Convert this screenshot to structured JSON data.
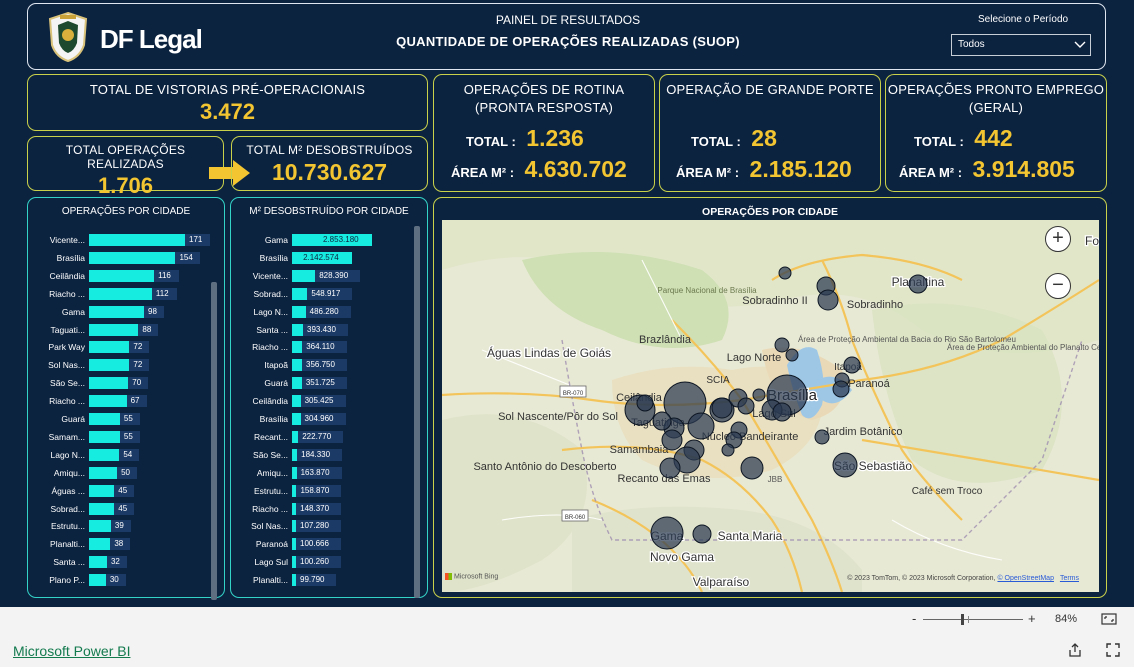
{
  "header": {
    "brand": "DF Legal",
    "title_line1": "PAINEL DE RESULTADOS",
    "title_line2": "QUANTIDADE DE OPERAÇÕES REALIZADAS (SUOP)",
    "period_label": "Selecione o Período",
    "period_value": "Todos"
  },
  "kpis": {
    "vistorias_label": "TOTAL DE VISTORIAS PRÉ-OPERACIONAIS",
    "vistorias_value": "3.472",
    "operacoes_label": "TOTAL OPERAÇÕES REALIZADAS",
    "operacoes_value": "1.706",
    "m2_label": "TOTAL M² DESOBSTRUÍDOS",
    "m2_value": "10.730.627",
    "total_label": "TOTAL :",
    "area_label": "ÁREA M² :",
    "rotina_title_1": "OPERAÇÕES DE ROTINA",
    "rotina_title_2": "(PRONTA RESPOSTA)",
    "rotina_total": "1.236",
    "rotina_area": "4.630.702",
    "grande_title": "OPERAÇÃO DE GRANDE PORTE",
    "grande_total": "28",
    "grande_area": "2.185.120",
    "pronto_title_1": "OPERAÇÕES PRONTO EMPREGO",
    "pronto_title_2": "(GERAL)",
    "pronto_total": "442",
    "pronto_area": "3.914.805"
  },
  "chart_ops": {
    "title": "OPERAÇÕES POR CIDADE",
    "max": 171,
    "rows": [
      {
        "label": "Vicente...",
        "value": 171,
        "text": "171"
      },
      {
        "label": "Brasília",
        "value": 154,
        "text": "154"
      },
      {
        "label": "Ceilândia",
        "value": 116,
        "text": "116"
      },
      {
        "label": "Riacho ...",
        "value": 112,
        "text": "112"
      },
      {
        "label": "Gama",
        "value": 98,
        "text": "98"
      },
      {
        "label": "Taguati...",
        "value": 88,
        "text": "88"
      },
      {
        "label": "Park Way",
        "value": 72,
        "text": "72"
      },
      {
        "label": "Sol Nas...",
        "value": 72,
        "text": "72"
      },
      {
        "label": "São Se...",
        "value": 70,
        "text": "70"
      },
      {
        "label": "Riacho ...",
        "value": 67,
        "text": "67"
      },
      {
        "label": "Guará",
        "value": 55,
        "text": "55"
      },
      {
        "label": "Samam...",
        "value": 55,
        "text": "55"
      },
      {
        "label": "Lago N...",
        "value": 54,
        "text": "54"
      },
      {
        "label": "Amiqu...",
        "value": 50,
        "text": "50"
      },
      {
        "label": "Águas ...",
        "value": 45,
        "text": "45"
      },
      {
        "label": "Sobrad...",
        "value": 45,
        "text": "45"
      },
      {
        "label": "Estrutu...",
        "value": 39,
        "text": "39"
      },
      {
        "label": "Planalti...",
        "value": 38,
        "text": "38"
      },
      {
        "label": "Santa ...",
        "value": 32,
        "text": "32"
      },
      {
        "label": "Plano P...",
        "value": 30,
        "text": "30"
      }
    ]
  },
  "chart_m2": {
    "title": "M² DESOBSTRUÍDO POR CIDADE",
    "max": 2853180,
    "rows": [
      {
        "label": "Gama",
        "value": 2853180,
        "text": "2.853.180"
      },
      {
        "label": "Brasília",
        "value": 2142574,
        "text": "2.142.574"
      },
      {
        "label": "Vicente...",
        "value": 828390,
        "text": "828.390"
      },
      {
        "label": "Sobrad...",
        "value": 548917,
        "text": "548.917"
      },
      {
        "label": "Lago N...",
        "value": 486280,
        "text": "486.280"
      },
      {
        "label": "Santa ...",
        "value": 393430,
        "text": "393.430"
      },
      {
        "label": "Riacho ...",
        "value": 364110,
        "text": "364.110"
      },
      {
        "label": "Itapoã",
        "value": 356750,
        "text": "356.750"
      },
      {
        "label": "Guará",
        "value": 351725,
        "text": "351.725"
      },
      {
        "label": "Ceilândia",
        "value": 305425,
        "text": "305.425"
      },
      {
        "label": "Brasília",
        "value": 304960,
        "text": "304.960"
      },
      {
        "label": "Recant...",
        "value": 222770,
        "text": "222.770"
      },
      {
        "label": "São Se...",
        "value": 184330,
        "text": "184.330"
      },
      {
        "label": "Amiqu...",
        "value": 163870,
        "text": "163.870"
      },
      {
        "label": "Estrutu...",
        "value": 158870,
        "text": "158.870"
      },
      {
        "label": "Riacho ...",
        "value": 148370,
        "text": "148.370"
      },
      {
        "label": "Sol Nas...",
        "value": 107280,
        "text": "107.280"
      },
      {
        "label": "Paranoá",
        "value": 100666,
        "text": "100.666"
      },
      {
        "label": "Lago Sul",
        "value": 100260,
        "text": "100.260"
      },
      {
        "label": "Planalti...",
        "value": 99790,
        "text": "99.790"
      }
    ]
  },
  "map": {
    "title": "OPERAÇÕES POR CIDADE",
    "zoom_in": "+",
    "zoom_out": "−",
    "bing": "Microsoft Bing",
    "copyright": "© 2023 TomTom, © 2023 Microsoft Corporation,",
    "osm": "© OpenStreetMap",
    "terms": "Terms",
    "places": [
      {
        "name": "Planaltina"
      },
      {
        "name": "Sobradinho II"
      },
      {
        "name": "Sobradinho"
      },
      {
        "name": "Parque Nacional de Brasília"
      },
      {
        "name": "Brazlândia"
      },
      {
        "name": "Águas Lindas de Goiás"
      },
      {
        "name": "Lago Norte"
      },
      {
        "name": "Itapoã"
      },
      {
        "name": "Paranoá"
      },
      {
        "name": "Área de Proteção Ambiental da Bacia do Rio São Bartolomeu"
      },
      {
        "name": "Área de Proteção Ambiental do Planalto Central"
      },
      {
        "name": "SCIA"
      },
      {
        "name": "Ceilândia"
      },
      {
        "name": "Brasília"
      },
      {
        "name": "Lago Sul"
      },
      {
        "name": "Sol Nascente/Pôr do Sol"
      },
      {
        "name": "Taguatinga"
      },
      {
        "name": "Núcleo Bandeirante"
      },
      {
        "name": "Samambaia"
      },
      {
        "name": "Jardim Botânico"
      },
      {
        "name": "São Sebastião"
      },
      {
        "name": "Santo Antônio do Descoberto"
      },
      {
        "name": "Recanto das Emas"
      },
      {
        "name": "JBB"
      },
      {
        "name": "Café sem Troco"
      },
      {
        "name": "Gama"
      },
      {
        "name": "Santa Maria"
      },
      {
        "name": "Novo Gama"
      },
      {
        "name": "Valparaíso"
      },
      {
        "name": "BR-070"
      },
      {
        "name": "BR-060"
      },
      {
        "name": "Fo"
      }
    ]
  },
  "status": {
    "minus": "-",
    "plus": "+",
    "zoom": "84%"
  },
  "footer": {
    "link": "Microsoft Power BI"
  }
}
